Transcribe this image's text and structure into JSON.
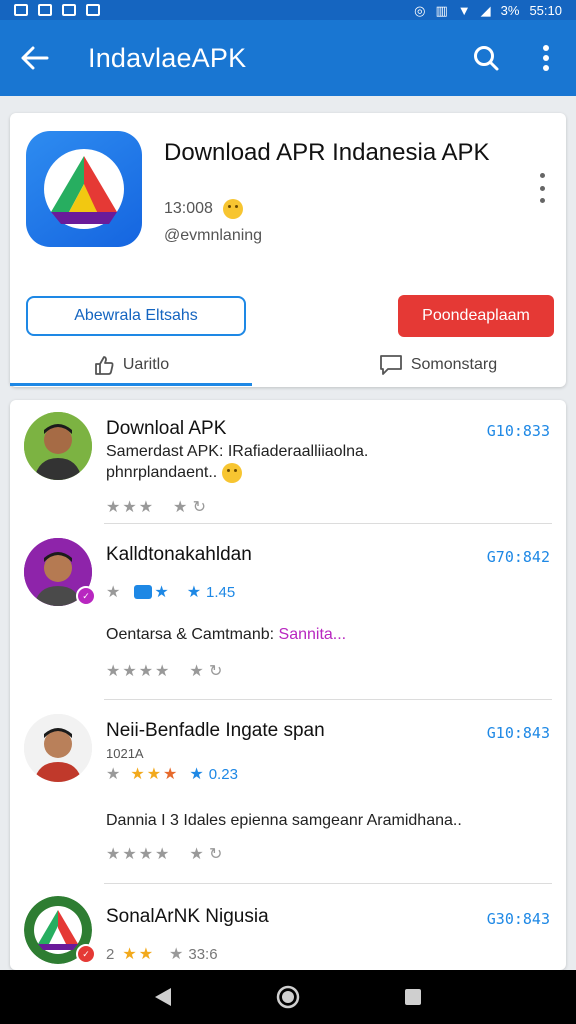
{
  "status_bar": {
    "battery": "3%",
    "time": "55:10"
  },
  "app_bar": {
    "title": "IndavlaeAPK"
  },
  "app": {
    "name": "Download APR Indanesia APK",
    "meta": "13:008",
    "developer": "@evmnlaning",
    "icon_color": "#1e7cf0"
  },
  "buttons": {
    "outline": "Abewrala Eltsahs",
    "primary": "Poondeaplaam"
  },
  "tabs": [
    {
      "label": "Uaritlo"
    },
    {
      "label": "Somonstarg"
    }
  ],
  "colors": {
    "primary": "#1976d2",
    "accent": "#e53935",
    "link": "#1e88e5"
  },
  "reviews": [
    {
      "name": "Downloal APK",
      "time": "G10:833",
      "text": "Samerdast APK: IRafiaderaalliiaolna. phnrplandaent..",
      "rating": {
        "stars": 3,
        "values": []
      }
    },
    {
      "name": "Kalldtonakahldan",
      "time": "G70:842",
      "text_prefix": "Oentarsa & Camtmanb: ",
      "text_highlight": "Sannita...",
      "rating": {
        "stars": 4,
        "value": "1.45"
      }
    },
    {
      "name": "Neii-Benfadle Ingate span",
      "subtitle": "1021A",
      "time": "G10:843",
      "text": "Dannia I 3 Idales epienna samgeanr Aramidhana..",
      "rating": {
        "stars": 3,
        "value": "0.23"
      }
    },
    {
      "name": "SonalArNK Nigusia",
      "time": "G30:843",
      "rating_label": "2",
      "rating_value": "33:6",
      "rating": {
        "stars": 2
      }
    }
  ],
  "nav": {
    "back": "back-icon",
    "home": "home-icon",
    "recents": "recents-icon"
  }
}
